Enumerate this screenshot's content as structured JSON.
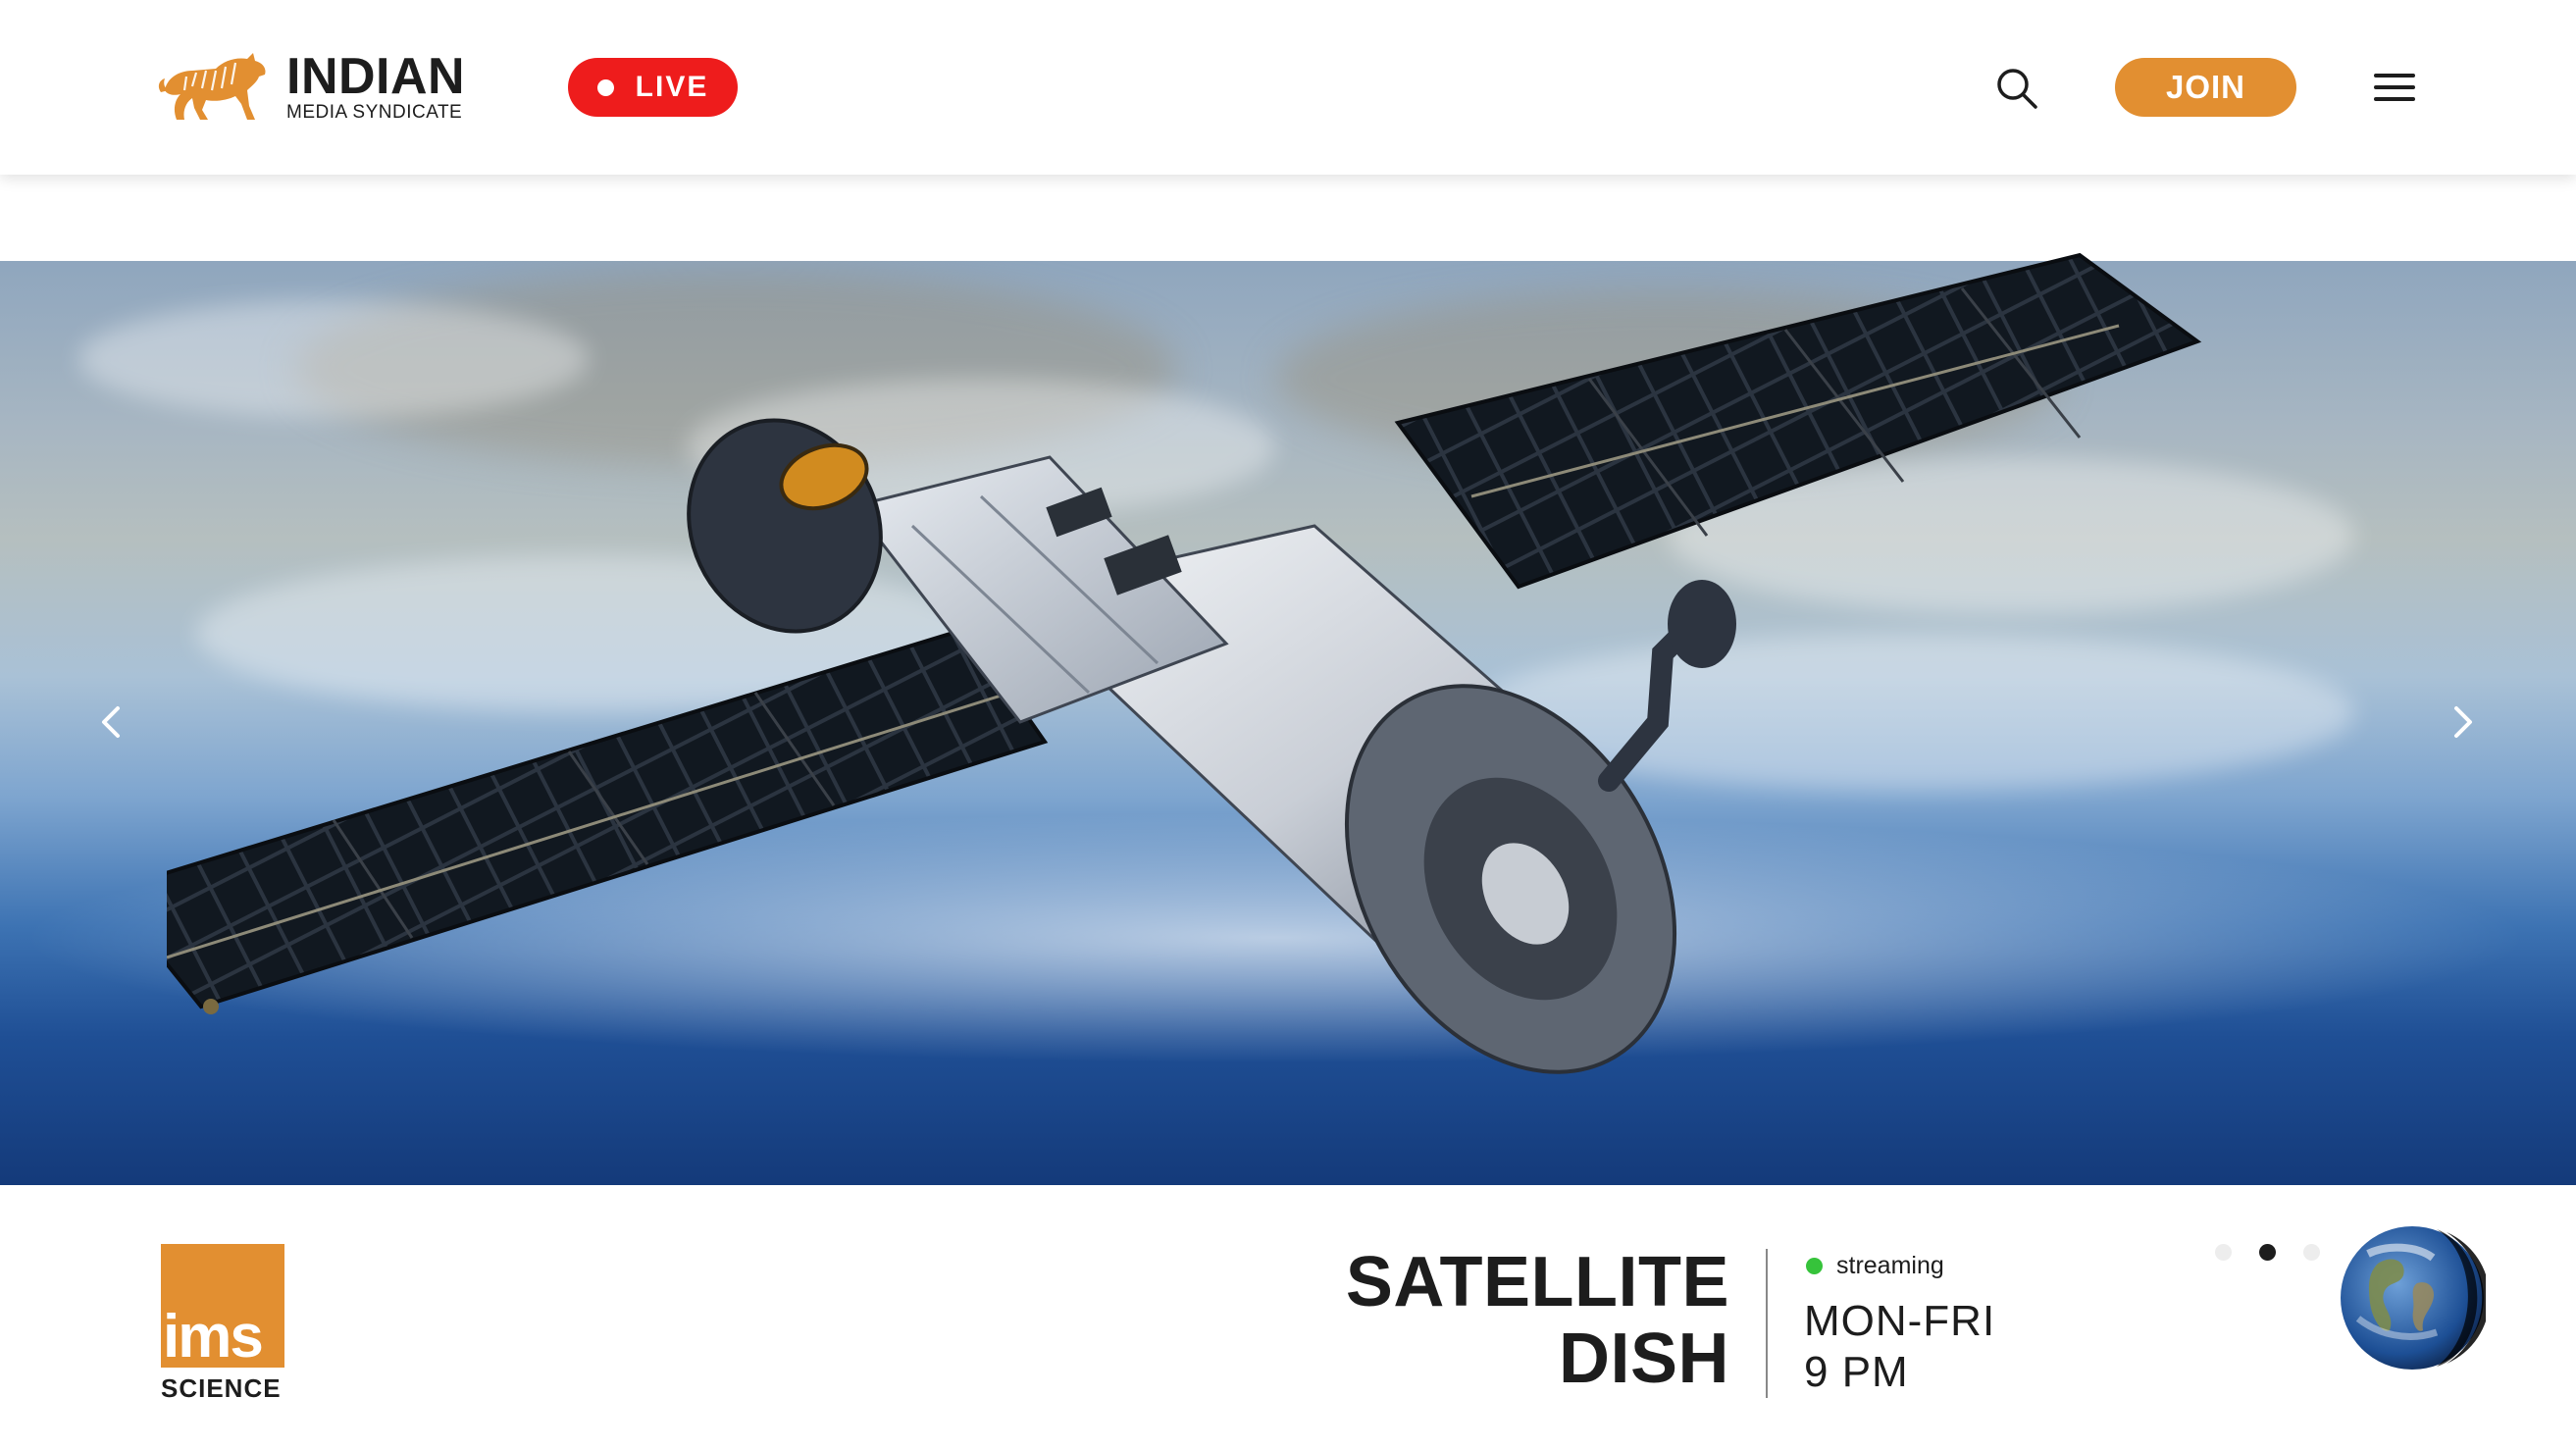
{
  "header": {
    "logo": {
      "main": "INDIAN",
      "sub": "MEDIA SYNDICATE",
      "icon": "tiger-logo-icon"
    },
    "live_label": "LIVE",
    "search_icon": "search-icon",
    "join_label": "JOIN",
    "menu_icon": "hamburger-menu-icon"
  },
  "hero": {
    "image": "satellite-in-orbit-over-earth",
    "prev_icon": "chevron-left-icon",
    "next_icon": "chevron-right-icon"
  },
  "channel": {
    "logo_text": "ims",
    "name": "SCIENCE"
  },
  "show": {
    "title_line1": "SATELLITE",
    "title_line2": "DISH",
    "status": "streaming",
    "days": "MON-FRI",
    "time": "9 PM"
  },
  "carousel": {
    "slides": 3,
    "active_index": 1
  },
  "colors": {
    "brand_orange": "#e28f31",
    "live_red": "#ee1c1c",
    "streaming_green": "#36c33b",
    "text_dark": "#1d1d1d"
  }
}
